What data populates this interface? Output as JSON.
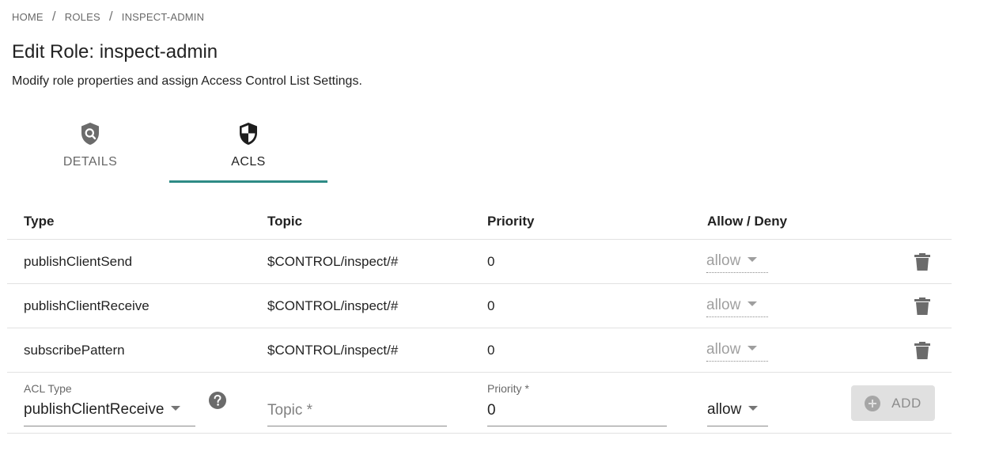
{
  "breadcrumb": {
    "home": "HOME",
    "roles": "ROLES",
    "current": "INSPECT-ADMIN",
    "separator": "/"
  },
  "page": {
    "title": "Edit Role: inspect-admin",
    "subtitle": "Modify role properties and assign Access Control List Settings."
  },
  "tabs": [
    {
      "label": "DETAILS",
      "icon": "shield-search-icon",
      "active": false
    },
    {
      "label": "ACLS",
      "icon": "shield-half-icon",
      "active": true
    }
  ],
  "colors": {
    "accent": "#2e8b86"
  },
  "table": {
    "headers": {
      "type": "Type",
      "topic": "Topic",
      "priority": "Priority",
      "allow": "Allow / Deny"
    },
    "rows": [
      {
        "type": "publishClientSend",
        "topic": "$CONTROL/inspect/#",
        "priority": "0",
        "allow": "allow"
      },
      {
        "type": "publishClientReceive",
        "topic": "$CONTROL/inspect/#",
        "priority": "0",
        "allow": "allow"
      },
      {
        "type": "subscribePattern",
        "topic": "$CONTROL/inspect/#",
        "priority": "0",
        "allow": "allow"
      }
    ]
  },
  "new_acl": {
    "acl_type_label": "ACL Type",
    "acl_type_value": "publishClientReceive",
    "topic_placeholder": "Topic *",
    "priority_label": "Priority *",
    "priority_value": "0",
    "allow_value": "allow",
    "add_label": "ADD"
  }
}
